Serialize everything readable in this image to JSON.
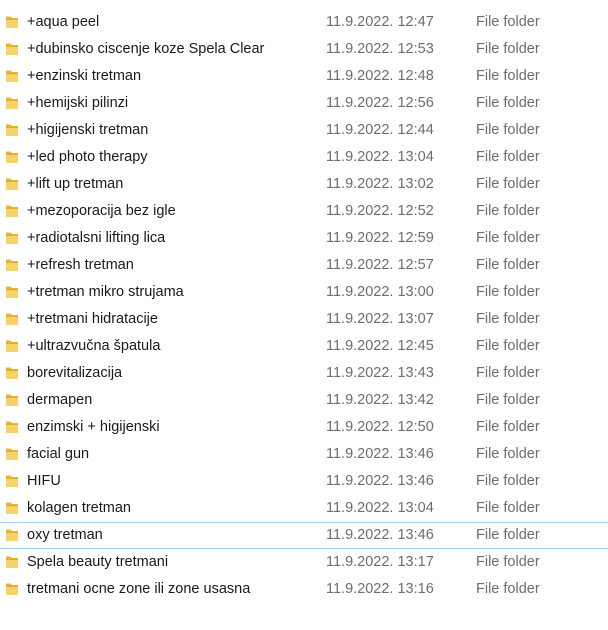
{
  "icon": "folder-icon",
  "colors": {
    "folder_front": "#f6d26b",
    "folder_back": "#e8b53b",
    "focus_border": "#99d1ff",
    "secondary_text": "#6d6d6d"
  },
  "rows": [
    {
      "name": "+aqua peel",
      "date": "11.9.2022. 12:47",
      "type": "File folder"
    },
    {
      "name": "+dubinsko ciscenje koze Spela Clear",
      "date": "11.9.2022. 12:53",
      "type": "File folder"
    },
    {
      "name": "+enzinski tretman",
      "date": "11.9.2022. 12:48",
      "type": "File folder"
    },
    {
      "name": "+hemijski pilinzi",
      "date": "11.9.2022. 12:56",
      "type": "File folder"
    },
    {
      "name": "+higijenski tretman",
      "date": "11.9.2022. 12:44",
      "type": "File folder"
    },
    {
      "name": "+led photo therapy",
      "date": "11.9.2022. 13:04",
      "type": "File folder"
    },
    {
      "name": "+lift up tretman",
      "date": "11.9.2022. 13:02",
      "type": "File folder"
    },
    {
      "name": "+mezoporacija bez igle",
      "date": "11.9.2022. 12:52",
      "type": "File folder"
    },
    {
      "name": "+radiotalsni lifting lica",
      "date": "11.9.2022. 12:59",
      "type": "File folder"
    },
    {
      "name": "+refresh tretman",
      "date": "11.9.2022. 12:57",
      "type": "File folder"
    },
    {
      "name": "+tretman mikro strujama",
      "date": "11.9.2022. 13:00",
      "type": "File folder"
    },
    {
      "name": "+tretmani hidratacije",
      "date": "11.9.2022. 13:07",
      "type": "File folder"
    },
    {
      "name": "+ultrazvučna špatula",
      "date": "11.9.2022. 12:45",
      "type": "File folder"
    },
    {
      "name": "borevitalizacija",
      "date": "11.9.2022. 13:43",
      "type": "File folder"
    },
    {
      "name": "dermapen",
      "date": "11.9.2022. 13:42",
      "type": "File folder"
    },
    {
      "name": "enzimski + higijenski",
      "date": "11.9.2022. 12:50",
      "type": "File folder"
    },
    {
      "name": "facial gun",
      "date": "11.9.2022. 13:46",
      "type": "File folder"
    },
    {
      "name": "HIFU",
      "date": "11.9.2022. 13:46",
      "type": "File folder"
    },
    {
      "name": "kolagen tretman",
      "date": "11.9.2022. 13:04",
      "type": "File folder"
    },
    {
      "name": "oxy tretman",
      "date": "11.9.2022. 13:46",
      "type": "File folder",
      "focused": true
    },
    {
      "name": "Spela beauty tretmani",
      "date": "11.9.2022. 13:17",
      "type": "File folder"
    },
    {
      "name": "tretmani ocne zone ili zone usasna",
      "date": "11.9.2022. 13:16",
      "type": "File folder"
    }
  ]
}
